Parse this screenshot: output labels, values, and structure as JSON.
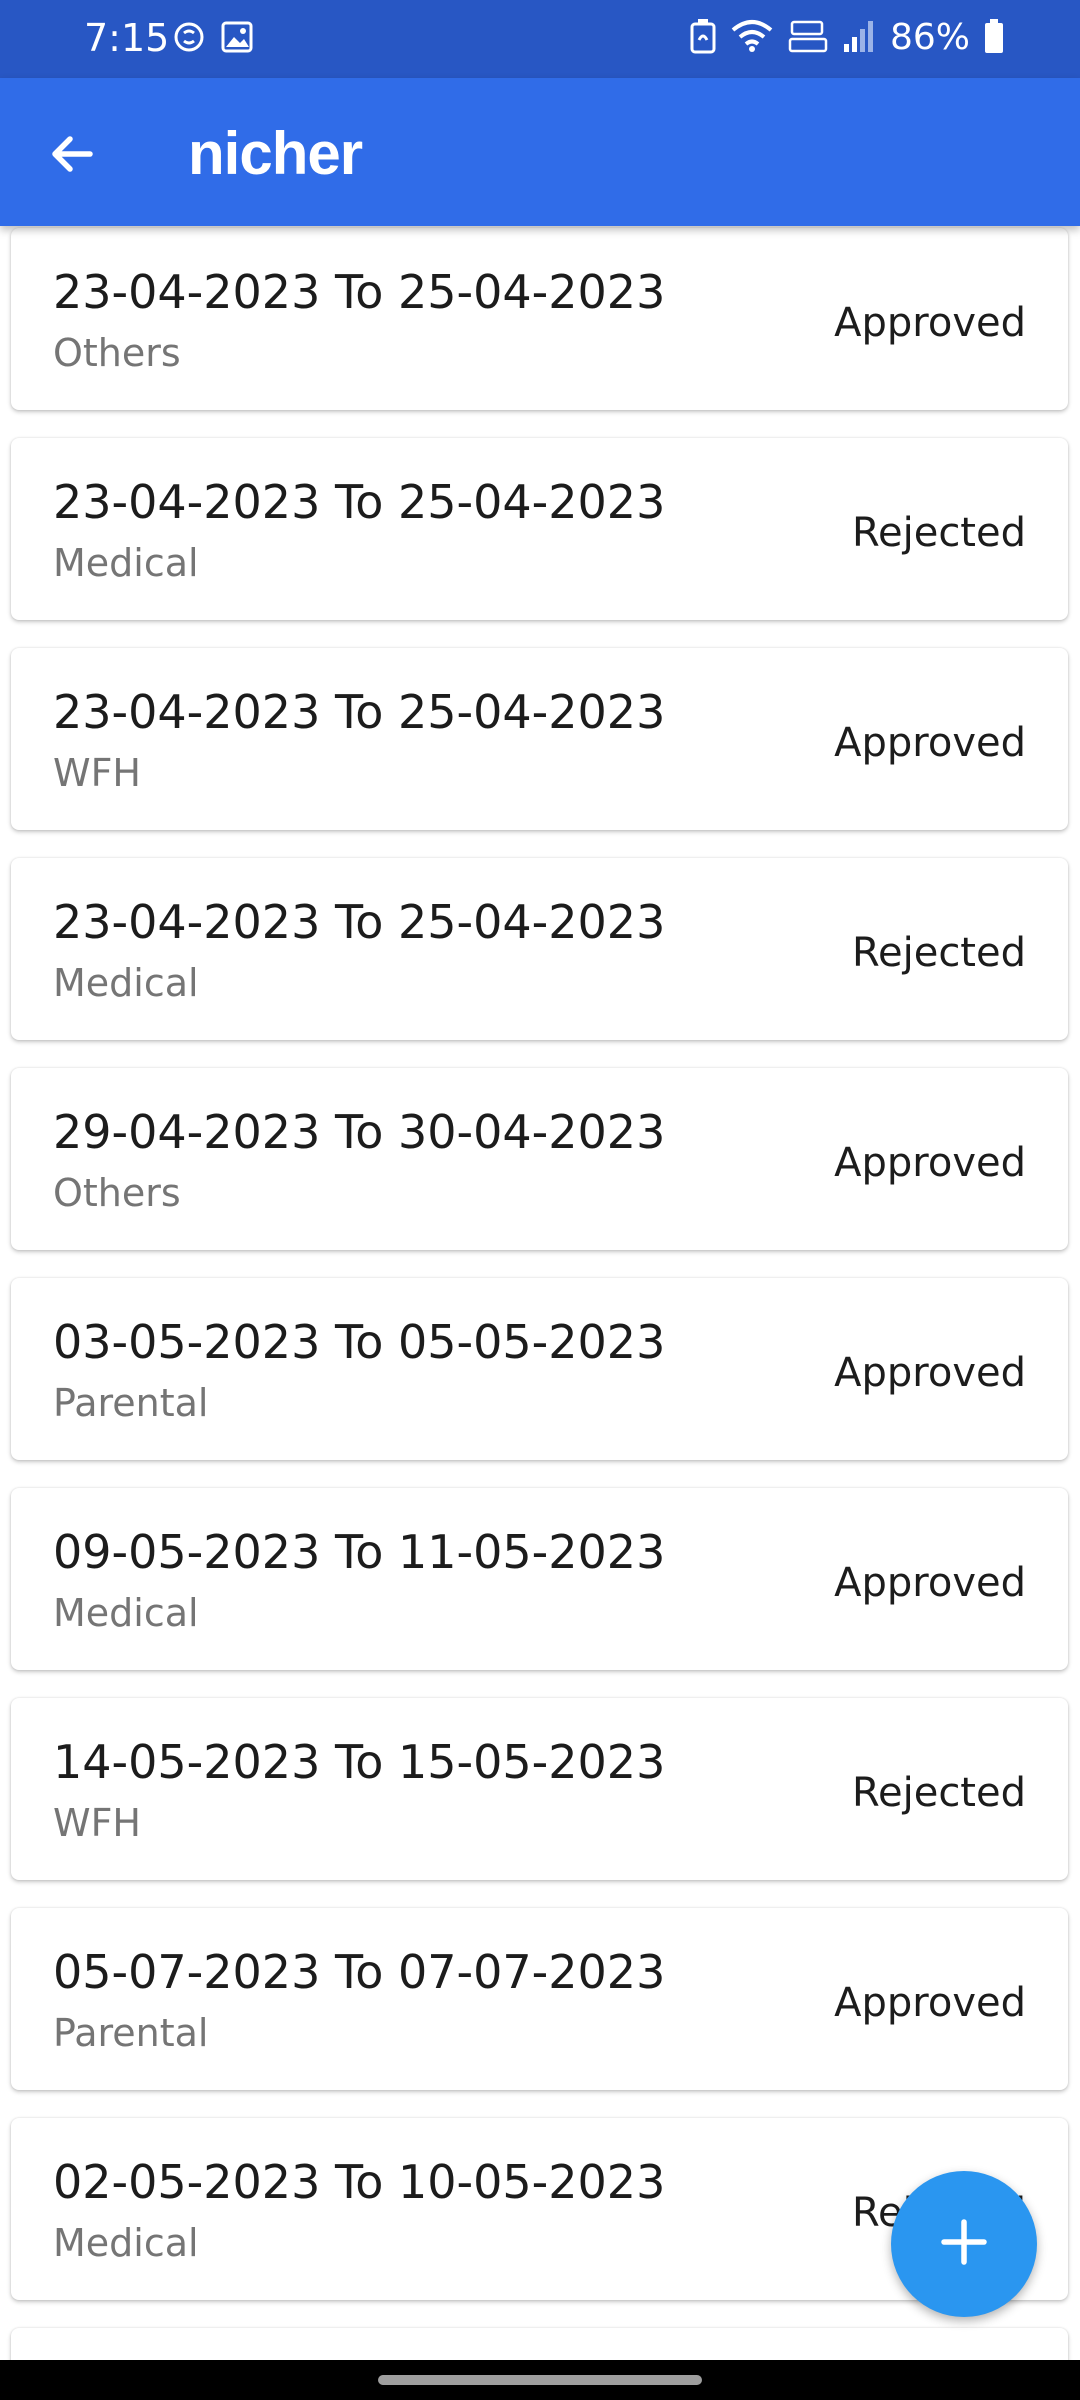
{
  "status_bar": {
    "time": "7:15",
    "battery": "86%",
    "left_icons": [
      "sync-badge-icon",
      "image-icon"
    ],
    "right_icons": [
      "battery-saver-icon",
      "wifi-icon",
      "volte-icon",
      "signal-icon",
      "battery-icon"
    ]
  },
  "app_bar": {
    "title": "nicher",
    "back_icon": "arrow-left-icon",
    "color": "#306ce8"
  },
  "leaves": [
    {
      "dates": "23-04-2023 To 25-04-2023",
      "type": "Others",
      "status": "Approved"
    },
    {
      "dates": "23-04-2023 To 25-04-2023",
      "type": "Medical",
      "status": "Rejected"
    },
    {
      "dates": "23-04-2023 To 25-04-2023",
      "type": "WFH",
      "status": "Approved"
    },
    {
      "dates": "23-04-2023 To 25-04-2023",
      "type": "Medical",
      "status": "Rejected"
    },
    {
      "dates": "29-04-2023 To 30-04-2023",
      "type": "Others",
      "status": "Approved"
    },
    {
      "dates": "03-05-2023 To 05-05-2023",
      "type": "Parental",
      "status": "Approved"
    },
    {
      "dates": "09-05-2023 To 11-05-2023",
      "type": "Medical",
      "status": "Approved"
    },
    {
      "dates": "14-05-2023 To 15-05-2023",
      "type": "WFH",
      "status": "Rejected"
    },
    {
      "dates": "05-07-2023 To 07-07-2023",
      "type": "Parental",
      "status": "Approved"
    },
    {
      "dates": "02-05-2023 To 10-05-2023",
      "type": "Medical",
      "status": "Rejected"
    },
    {
      "dates": "",
      "type": "",
      "status": ""
    }
  ],
  "fab": {
    "icon": "plus-icon",
    "color": "#2a96f0"
  }
}
